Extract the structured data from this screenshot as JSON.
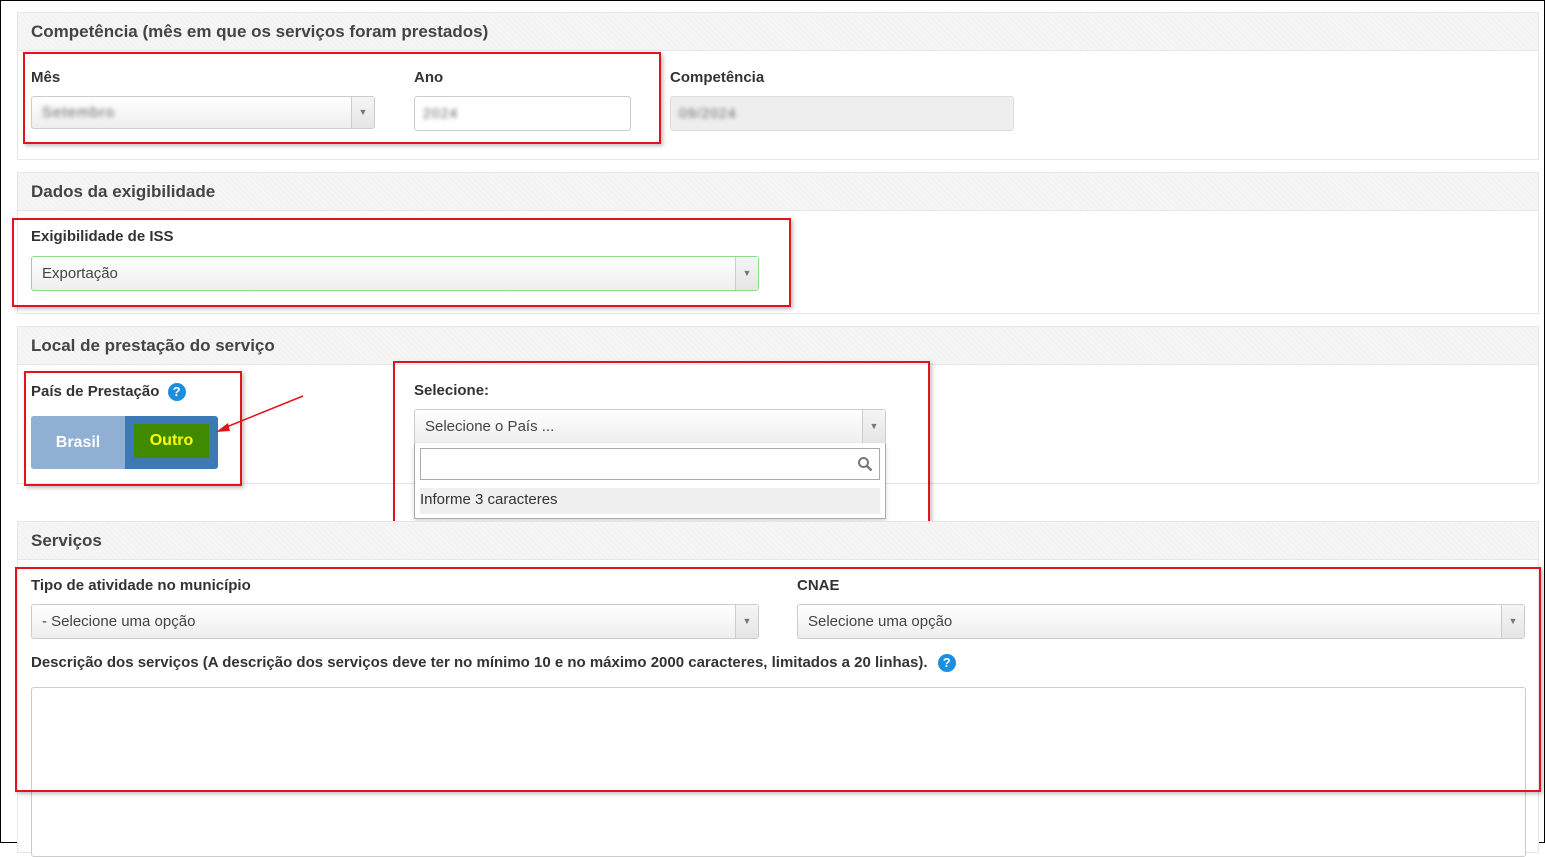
{
  "competencia": {
    "title": "Competência (mês em que os serviços foram prestados)",
    "mes_label": "Mês",
    "mes_value": "Setembro",
    "ano_label": "Ano",
    "ano_value": "2024",
    "competencia_label": "Competência",
    "competencia_value": "09/2024"
  },
  "exigibilidade": {
    "title": "Dados da exigibilidade",
    "label": "Exigibilidade de ISS",
    "value": "Exportação"
  },
  "local": {
    "title": "Local de prestação do serviço",
    "pais_label": "País de Prestação",
    "help_icon": "?",
    "toggle_brasil": "Brasil",
    "toggle_outro": "Outro",
    "selecione_label": "Selecione:",
    "pais_placeholder": "Selecione o País ...",
    "dropdown_hint": "Informe 3 caracteres"
  },
  "servicos": {
    "title": "Serviços",
    "tipo_label": "Tipo de atividade no município",
    "tipo_value": "- Selecione uma opção",
    "cnae_label": "CNAE",
    "cnae_value": "Selecione uma opção",
    "descricao_label": "Descrição dos serviços (A descrição dos serviços deve ter no mínimo 10 e no máximo 2000 caracteres, limitados a 20 linhas).",
    "help_icon": "?"
  },
  "colors": {
    "highlight_red": "#e3131b",
    "toggle_off": "#8fb0d3",
    "toggle_on": "#3d79b5",
    "outro_bg": "#3f8a00",
    "outro_text": "#ffff00",
    "help_blue": "#1a8fe0",
    "valid_green": "#8bdc8b"
  }
}
